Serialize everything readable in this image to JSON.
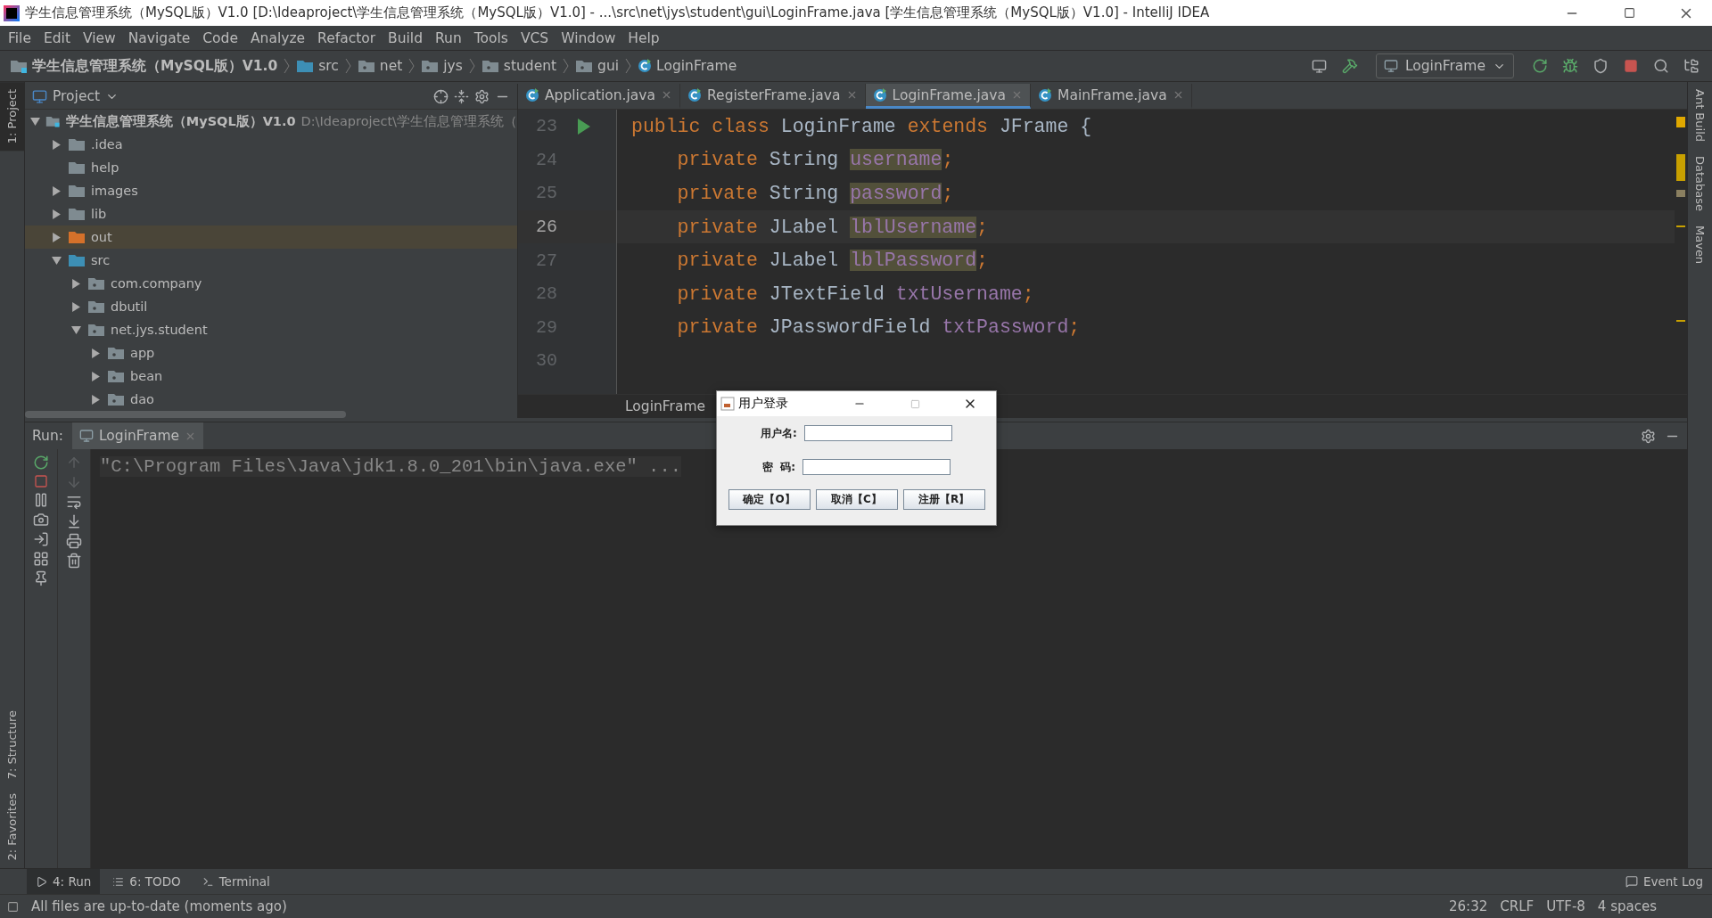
{
  "window": {
    "title": "学生信息管理系统（MySQL版）V1.0 [D:\\Ideaproject\\学生信息管理系统（MySQL版）V1.0] - ...\\src\\net\\jys\\student\\gui\\LoginFrame.java [学生信息管理系统（MySQL版）V1.0] - IntelliJ IDEA"
  },
  "menu": [
    "File",
    "Edit",
    "View",
    "Navigate",
    "Code",
    "Analyze",
    "Refactor",
    "Build",
    "Run",
    "Tools",
    "VCS",
    "Window",
    "Help"
  ],
  "breadcrumb": [
    {
      "label": "学生信息管理系统（MySQL版）V1.0",
      "kind": "project"
    },
    {
      "label": "src",
      "kind": "source"
    },
    {
      "label": "net",
      "kind": "package"
    },
    {
      "label": "jys",
      "kind": "package"
    },
    {
      "label": "student",
      "kind": "package"
    },
    {
      "label": "gui",
      "kind": "package"
    },
    {
      "label": "LoginFrame",
      "kind": "class"
    }
  ],
  "run_configuration": "LoginFrame",
  "left_tool_tabs": [
    {
      "label": "1: Project",
      "selected": true
    },
    {
      "label": "7: Structure",
      "selected": false
    },
    {
      "label": "2: Favorites",
      "selected": false
    }
  ],
  "right_tool_tabs": [
    "Ant Build",
    "Database",
    "Maven"
  ],
  "project": {
    "title": "Project",
    "tree": [
      {
        "label": "学生信息管理系统（MySQL版）V1.0",
        "path": "D:\\Ideaproject\\学生信息管理系统（",
        "kind": "module",
        "expanded": true,
        "selected": false,
        "children": [
          {
            "label": ".idea",
            "kind": "folder",
            "expanded": false,
            "selected": false
          },
          {
            "label": "help",
            "kind": "folder",
            "selected": false
          },
          {
            "label": "images",
            "kind": "folder",
            "expanded": false,
            "selected": false
          },
          {
            "label": "lib",
            "kind": "folder",
            "expanded": false,
            "selected": false
          },
          {
            "label": "out",
            "kind": "excluded",
            "expanded": false,
            "selected": true
          },
          {
            "label": "src",
            "kind": "source",
            "expanded": true,
            "selected": false,
            "children": [
              {
                "label": "com.company",
                "kind": "package",
                "expanded": false,
                "selected": false
              },
              {
                "label": "dbutil",
                "kind": "package",
                "expanded": false,
                "selected": false
              },
              {
                "label": "net.jys.student",
                "kind": "package",
                "expanded": true,
                "selected": false,
                "children": [
                  {
                    "label": "app",
                    "kind": "package",
                    "expanded": false,
                    "selected": false
                  },
                  {
                    "label": "bean",
                    "kind": "package",
                    "expanded": false,
                    "selected": false
                  },
                  {
                    "label": "dao",
                    "kind": "package",
                    "expanded": false,
                    "selected": false
                  }
                ]
              }
            ]
          }
        ]
      }
    ]
  },
  "editor": {
    "tabs": [
      {
        "label": "Application.java",
        "selected": false
      },
      {
        "label": "RegisterFrame.java",
        "selected": false
      },
      {
        "label": "LoginFrame.java",
        "selected": true
      },
      {
        "label": "MainFrame.java",
        "selected": false
      }
    ],
    "lines": [
      {
        "number": "23",
        "current": false,
        "run_marker": true,
        "tokens": [
          {
            "text": "public class ",
            "kind": "keyword"
          },
          {
            "text": "LoginFrame ",
            "kind": "plain"
          },
          {
            "text": "extends ",
            "kind": "keyword"
          },
          {
            "text": "JFrame {",
            "kind": "plain"
          }
        ]
      },
      {
        "number": "24",
        "current": false,
        "tokens": [
          {
            "text": "    private ",
            "kind": "keyword"
          },
          {
            "text": "String ",
            "kind": "plain"
          },
          {
            "text": "username",
            "kind": "field",
            "highlight": true
          },
          {
            "text": ";",
            "kind": "punct"
          }
        ]
      },
      {
        "number": "25",
        "current": false,
        "tokens": [
          {
            "text": "    private ",
            "kind": "keyword"
          },
          {
            "text": "String ",
            "kind": "plain"
          },
          {
            "text": "password",
            "kind": "field",
            "highlight": true
          },
          {
            "text": ";",
            "kind": "punct"
          }
        ]
      },
      {
        "number": "26",
        "current": true,
        "tokens": [
          {
            "text": "    private ",
            "kind": "keyword"
          },
          {
            "text": "JLabel ",
            "kind": "plain"
          },
          {
            "text": "lblUsername",
            "kind": "field",
            "highlight": true
          },
          {
            "text": ";",
            "kind": "punct"
          }
        ]
      },
      {
        "number": "27",
        "current": false,
        "tokens": [
          {
            "text": "    private ",
            "kind": "keyword"
          },
          {
            "text": "JLabel ",
            "kind": "plain"
          },
          {
            "text": "lblPassword",
            "kind": "field",
            "highlight": true
          },
          {
            "text": ";",
            "kind": "punct"
          }
        ]
      },
      {
        "number": "28",
        "current": false,
        "tokens": [
          {
            "text": "    private ",
            "kind": "keyword"
          },
          {
            "text": "JTextField ",
            "kind": "plain"
          },
          {
            "text": "txtUsername",
            "kind": "field"
          },
          {
            "text": ";",
            "kind": "punct"
          }
        ]
      },
      {
        "number": "29",
        "current": false,
        "tokens": [
          {
            "text": "    private ",
            "kind": "keyword"
          },
          {
            "text": "JPasswordField ",
            "kind": "plain"
          },
          {
            "text": "txtPassword",
            "kind": "field"
          },
          {
            "text": ";",
            "kind": "punct"
          }
        ]
      },
      {
        "number": "30",
        "current": false
      }
    ],
    "footer": "LoginFrame"
  },
  "run": {
    "label": "Run:",
    "tab": "LoginFrame",
    "console": "\"C:\\Program Files\\Java\\jdk1.8.0_201\\bin\\java.exe\" ..."
  },
  "dialog": {
    "title": "用户登录",
    "fields": [
      {
        "label": "用户名:"
      },
      {
        "label": "密  码:"
      }
    ],
    "buttons": [
      "确定【O】",
      "取消【C】",
      "注册【R】"
    ]
  },
  "bottom_tabs": [
    {
      "label": "4: Run",
      "selected": true,
      "kind": "run"
    },
    {
      "label": "6: TODO",
      "selected": false,
      "kind": "todo"
    },
    {
      "label": "Terminal",
      "selected": false,
      "kind": "terminal"
    }
  ],
  "event_log": "Event Log",
  "status": {
    "message": "All files are up-to-date (moments ago)",
    "items": [
      "26:32",
      "CRLF",
      "UTF-8",
      "4 spaces"
    ]
  }
}
